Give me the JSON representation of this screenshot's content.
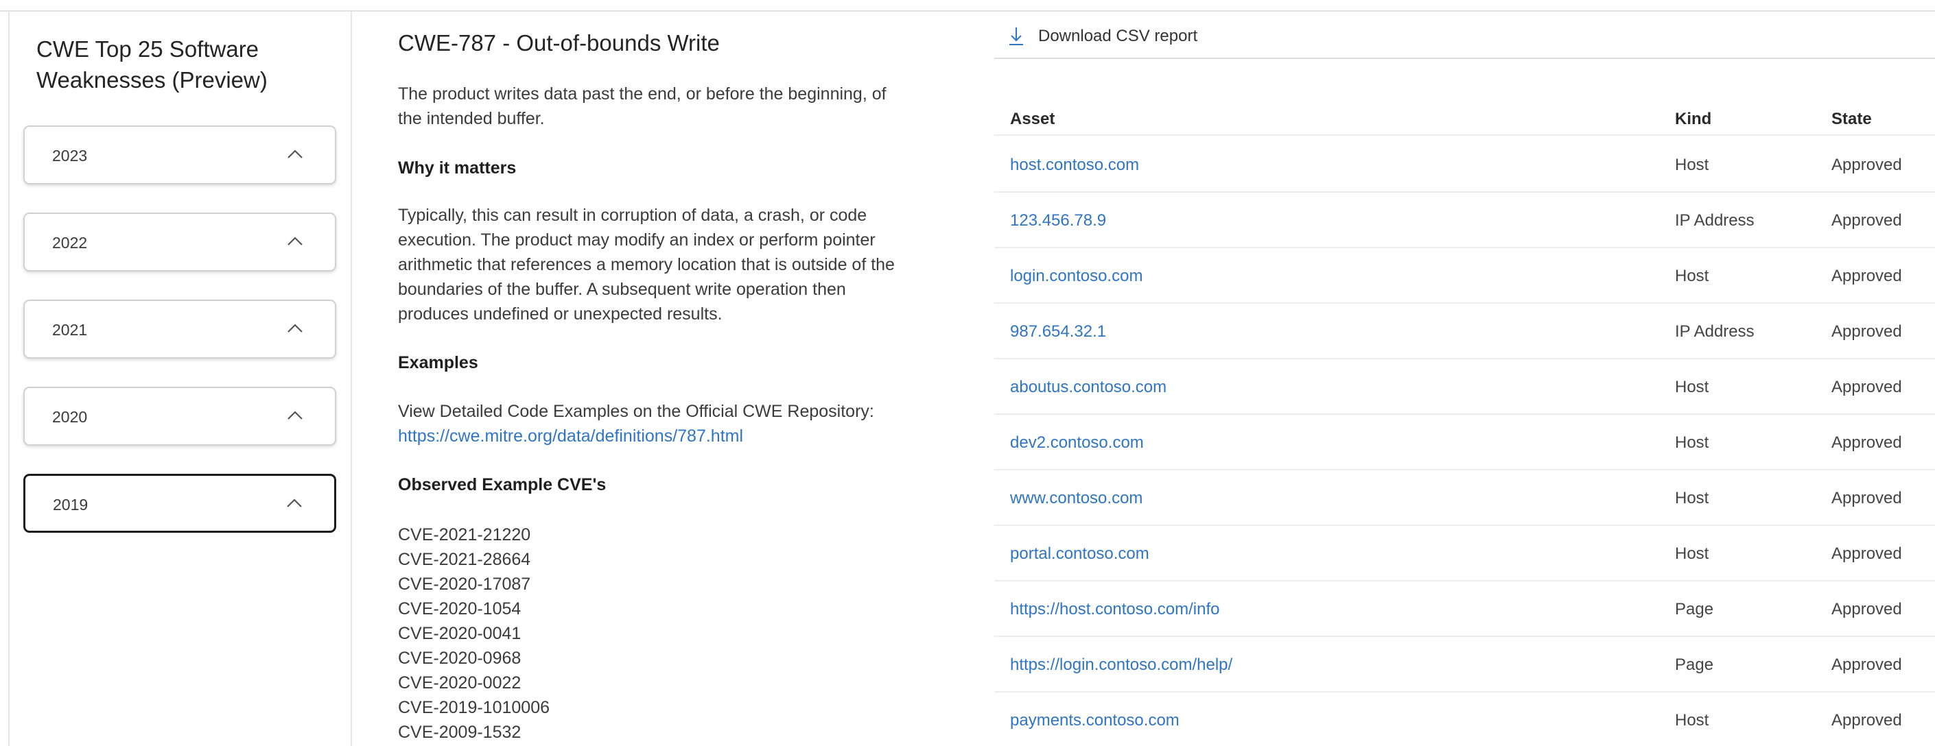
{
  "sidebar": {
    "title": "CWE Top 25 Software Weaknesses (Preview)",
    "years": [
      {
        "label": "2023",
        "selected": false
      },
      {
        "label": "2022",
        "selected": false
      },
      {
        "label": "2021",
        "selected": false
      },
      {
        "label": "2020",
        "selected": false
      },
      {
        "label": "2019",
        "selected": true
      }
    ]
  },
  "detail": {
    "title": "CWE-787 - Out-of-bounds Write",
    "description": "The product writes data past the end, or before the beginning, of the intended buffer.",
    "why_heading": "Why it matters",
    "why_text": "Typically, this can result in corruption of data, a crash, or code execution. The product may modify an index or perform pointer arithmetic that references a memory location that is outside of the boundaries of the buffer. A subsequent write operation then produces undefined or unexpected results.",
    "examples_heading": "Examples",
    "examples_text": "View Detailed Code Examples on the Official CWE Repository:",
    "examples_link": "https://cwe.mitre.org/data/definitions/787.html",
    "observed_heading": "Observed Example CVE's",
    "cves": [
      "CVE-2021-21220",
      "CVE-2021-28664",
      "CVE-2020-17087",
      "CVE-2020-1054",
      "CVE-2020-0041",
      "CVE-2020-0968",
      "CVE-2020-0022",
      "CVE-2019-1010006",
      "CVE-2009-1532"
    ]
  },
  "toolbar": {
    "download_label": "Download CSV report"
  },
  "table": {
    "columns": {
      "asset": "Asset",
      "kind": "Kind",
      "state": "State"
    },
    "rows": [
      {
        "asset": "host.contoso.com",
        "kind": "Host",
        "state": "Approved"
      },
      {
        "asset": "123.456.78.9",
        "kind": "IP Address",
        "state": "Approved"
      },
      {
        "asset": "login.contoso.com",
        "kind": "Host",
        "state": "Approved"
      },
      {
        "asset": "987.654.32.1",
        "kind": "IP Address",
        "state": "Approved"
      },
      {
        "asset": "aboutus.contoso.com",
        "kind": "Host",
        "state": "Approved"
      },
      {
        "asset": "dev2.contoso.com",
        "kind": "Host",
        "state": "Approved"
      },
      {
        "asset": "www.contoso.com",
        "kind": "Host",
        "state": "Approved"
      },
      {
        "asset": "portal.contoso.com",
        "kind": "Host",
        "state": "Approved"
      },
      {
        "asset": "https://host.contoso.com/info",
        "kind": "Page",
        "state": "Approved"
      },
      {
        "asset": "https://login.contoso.com/help/",
        "kind": "Page",
        "state": "Approved"
      },
      {
        "asset": "payments.contoso.com",
        "kind": "Host",
        "state": "Approved"
      }
    ]
  },
  "colors": {
    "link": "#2f75c7",
    "selected_border": "#1b1b1b",
    "card_border": "#d1d1d1",
    "divider": "#e6e6e6"
  }
}
